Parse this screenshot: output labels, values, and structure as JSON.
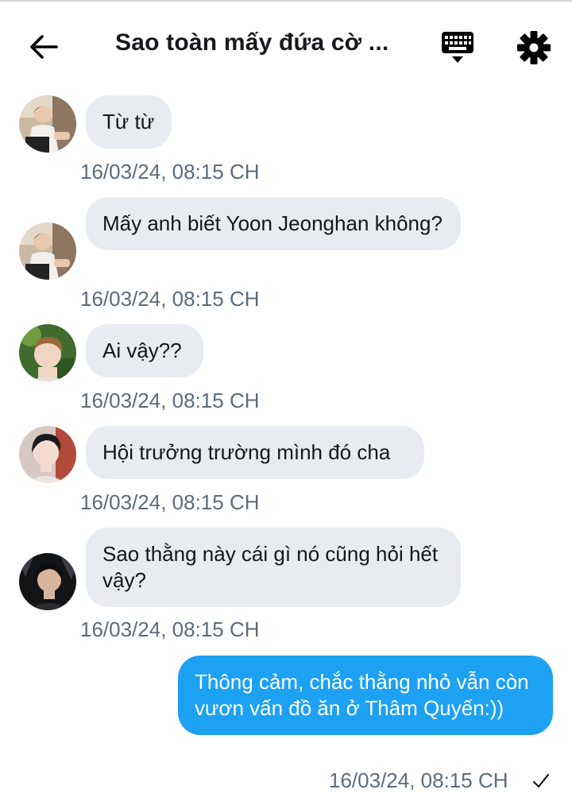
{
  "header": {
    "back_icon": "arrow-left-icon",
    "title": "Sao toàn mấy đứa cờ ...",
    "keyboard_icon": "keyboard-icon",
    "settings_icon": "gear-icon"
  },
  "messages": [
    {
      "text": "Từ từ",
      "time": "16/03/24, 08:15 CH",
      "avatar": "avatar-1"
    },
    {
      "text": "Mấy anh biết Yoon Jeonghan không?",
      "time": "16/03/24, 08:15 CH",
      "avatar": "avatar-1"
    },
    {
      "text": "Ai vậy??",
      "time": "16/03/24, 08:15 CH",
      "avatar": "avatar-2"
    },
    {
      "text": "Hội trưởng trường mình đó cha",
      "time": "16/03/24, 08:15 CH",
      "avatar": "avatar-3"
    },
    {
      "text": "Sao thằng này cái gì nó cũng hỏi hết vậy?",
      "time": "16/03/24, 08:15 CH",
      "avatar": "avatar-4"
    }
  ],
  "outgoing": {
    "text": "Thông cảm, chắc thằng nhỏ vẫn còn vươn vấn đồ ăn ở Thâm Quyến:))",
    "time": "16/03/24, 08:15 CH",
    "status_icon": "checkmark-icon"
  },
  "colors": {
    "bubble_in": "#e8ecf0",
    "bubble_out": "#1da1f2",
    "timestamp": "#5c6c7a"
  }
}
